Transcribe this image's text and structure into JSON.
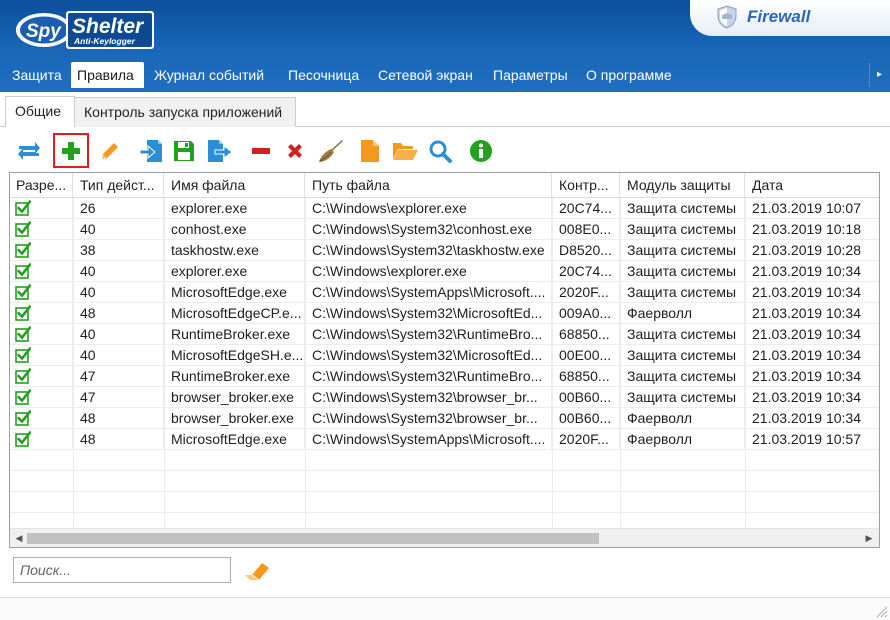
{
  "brand": {
    "spy": "Spy",
    "shelter": "Shelter",
    "sub": "Anti-Keylogger"
  },
  "header": {
    "firewall_label": "Firewall",
    "close_glyph": "✕"
  },
  "menu": {
    "items": [
      {
        "label": "Защита"
      },
      {
        "label": "Правила"
      },
      {
        "label": "Журнал событий"
      },
      {
        "label": "Песочница"
      },
      {
        "label": "Сетевой экран"
      },
      {
        "label": "Параметры"
      },
      {
        "label": "О программе"
      }
    ],
    "active_index": 1,
    "scroll_glyph": "▸"
  },
  "subtabs": {
    "general": "Общие",
    "app_control": "Контроль запуска приложений"
  },
  "toolbar": {
    "buttons": [
      {
        "icon": "refresh-icon"
      },
      {
        "icon": "add-icon"
      },
      {
        "icon": "edit-icon"
      },
      {
        "icon": "import-icon"
      },
      {
        "icon": "save-icon"
      },
      {
        "icon": "export-icon"
      },
      {
        "icon": "remove-icon"
      },
      {
        "icon": "delete-icon"
      },
      {
        "icon": "clean-icon"
      },
      {
        "icon": "new-file-icon"
      },
      {
        "icon": "open-folder-icon"
      },
      {
        "icon": "search-icon"
      },
      {
        "icon": "info-icon"
      }
    ],
    "highlighted": "add-icon"
  },
  "grid": {
    "columns": [
      "Разре...",
      "Тип дейст...",
      "Имя файла",
      "Путь файла",
      "Контр...",
      "Модуль защиты",
      "Дата"
    ],
    "rows": [
      {
        "type": "26",
        "name": "explorer.exe",
        "path": "C:\\Windows\\explorer.exe",
        "hash": "20C74...",
        "module": "Защита системы",
        "date": "21.03.2019 10:07"
      },
      {
        "type": "40",
        "name": "conhost.exe",
        "path": "C:\\Windows\\System32\\conhost.exe",
        "hash": "008E0...",
        "module": "Защита системы",
        "date": "21.03.2019 10:18"
      },
      {
        "type": "38",
        "name": "taskhostw.exe",
        "path": "C:\\Windows\\System32\\taskhostw.exe",
        "hash": "D8520...",
        "module": "Защита системы",
        "date": "21.03.2019 10:28"
      },
      {
        "type": "40",
        "name": "explorer.exe",
        "path": "C:\\Windows\\explorer.exe",
        "hash": "20C74...",
        "module": "Защита системы",
        "date": "21.03.2019 10:34"
      },
      {
        "type": "40",
        "name": "MicrosoftEdge.exe",
        "path": "C:\\Windows\\SystemApps\\Microsoft....",
        "hash": "2020F...",
        "module": "Защита системы",
        "date": "21.03.2019 10:34"
      },
      {
        "type": "48",
        "name": "MicrosoftEdgeCP.e...",
        "path": "C:\\Windows\\System32\\MicrosoftEd...",
        "hash": "009A0...",
        "module": "Фаерволл",
        "date": "21.03.2019 10:34"
      },
      {
        "type": "40",
        "name": "RuntimeBroker.exe",
        "path": "C:\\Windows\\System32\\RuntimeBro...",
        "hash": "68850...",
        "module": "Защита системы",
        "date": "21.03.2019 10:34"
      },
      {
        "type": "40",
        "name": "MicrosoftEdgeSH.e...",
        "path": "C:\\Windows\\System32\\MicrosoftEd...",
        "hash": "00E00...",
        "module": "Защита системы",
        "date": "21.03.2019 10:34"
      },
      {
        "type": "47",
        "name": "RuntimeBroker.exe",
        "path": "C:\\Windows\\System32\\RuntimeBro...",
        "hash": "68850...",
        "module": "Защита системы",
        "date": "21.03.2019 10:34"
      },
      {
        "type": "47",
        "name": "browser_broker.exe",
        "path": "C:\\Windows\\System32\\browser_br...",
        "hash": "00B60...",
        "module": "Защита системы",
        "date": "21.03.2019 10:34"
      },
      {
        "type": "48",
        "name": "browser_broker.exe",
        "path": "C:\\Windows\\System32\\browser_br...",
        "hash": "00B60...",
        "module": "Фаерволл",
        "date": "21.03.2019 10:34"
      },
      {
        "type": "48",
        "name": "MicrosoftEdge.exe",
        "path": "C:\\Windows\\SystemApps\\Microsoft....",
        "hash": "2020F...",
        "module": "Фаерволл",
        "date": "21.03.2019 10:57"
      }
    ],
    "empty_rows": 4,
    "scroll": {
      "left_glyph": "◀",
      "right_glyph": "▶"
    }
  },
  "search": {
    "placeholder": "Поиск..."
  },
  "colors": {
    "header": "#1a67b8",
    "accent_green": "#23a020",
    "accent_orange": "#f39a1e",
    "accent_blue": "#2c8fd6",
    "accent_red": "#d02020"
  }
}
